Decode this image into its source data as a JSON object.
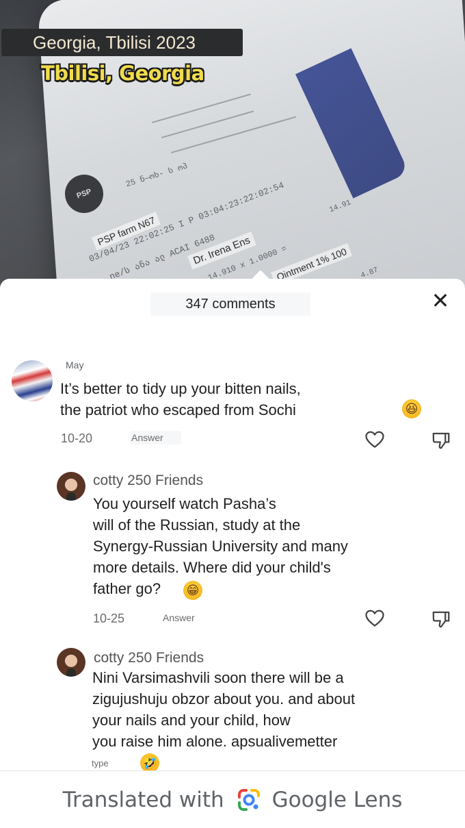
{
  "video": {
    "location_tag": "Georgia, Tbilisi 2023",
    "location_caption": "Tbilisi, Georgia",
    "receipt": {
      "logo": "PSP",
      "line_small": "25 ნ—ოხ- ს ოპ",
      "line_store": "PSP farm N67",
      "line_dates": "03/04/23  22:02:25  I P 03:04:23:22:02:54",
      "line_product": "ne/ს ანა  ალ  ACAI 6488",
      "line_doctor": "Dr. Irena Ens",
      "line_price": "14.910 x 1.0000 =",
      "line_price_right": "14.91",
      "line_ointment": "Ointment 1% 100",
      "line_bottom": "4.87"
    }
  },
  "sheet": {
    "comments_count": "347 comments",
    "close_icon": "close-icon"
  },
  "comments": [
    {
      "author": "May",
      "lines": [
        "It’s better to tidy up your bitten nails,",
        "the patriot who escaped from Sochi"
      ],
      "date": "10-20",
      "answer": "Answer",
      "emoji": "😆"
    }
  ],
  "replies": [
    {
      "author": "cotty 250 Friends",
      "lines": [
        "You yourself watch Pasha’s",
        "will of the Russian, study at the",
        "Synergy-Russian University and many",
        "more details. Where did your child's",
        "father go?"
      ],
      "date": "10-25",
      "answer": "Answer",
      "emoji": "😁"
    },
    {
      "author": "cotty 250 Friends",
      "lines": [
        "Nini Varsimashvili soon there will be a",
        "zigujushuju obzor about you. and about",
        "your nails and your child, how",
        "you raise him alone. apsualivemetter"
      ],
      "answer": "type",
      "emoji": "🤣"
    }
  ],
  "footer": {
    "translated_with": "Translated with",
    "google_lens": "Google Lens"
  }
}
